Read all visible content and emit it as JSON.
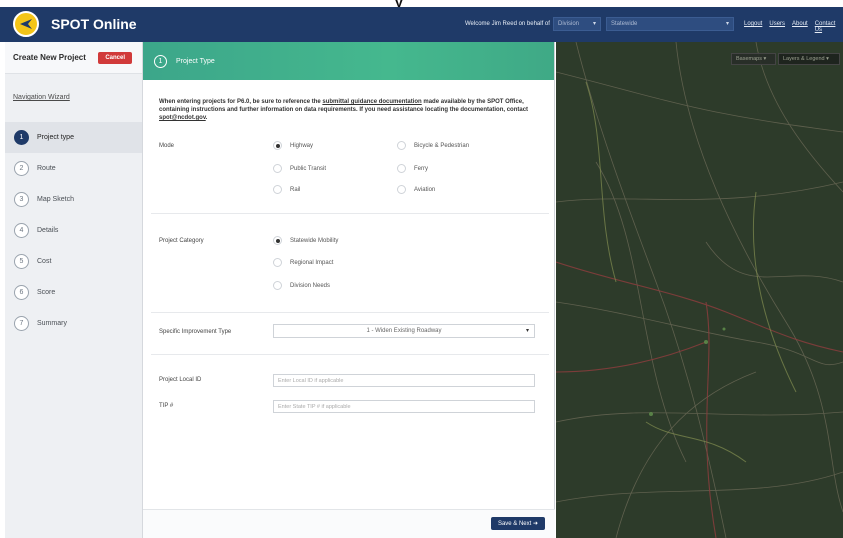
{
  "header": {
    "app_title": "SPOT Online",
    "welcome_text": "Welcome Jim Reed on behalf of",
    "region_select_value": "Division",
    "entity_select_value": "Statewide",
    "links": [
      "Logout",
      "Users",
      "About",
      "Contact Us"
    ]
  },
  "sidebar": {
    "title": "Create New Project",
    "cancel_label": "Cancel",
    "nav_wizard_label": "Navigation Wizard",
    "steps": [
      {
        "num": "1",
        "label": "Project type"
      },
      {
        "num": "2",
        "label": "Route"
      },
      {
        "num": "3",
        "label": "Map Sketch"
      },
      {
        "num": "4",
        "label": "Details"
      },
      {
        "num": "5",
        "label": "Cost"
      },
      {
        "num": "6",
        "label": "Score"
      },
      {
        "num": "7",
        "label": "Summary"
      }
    ]
  },
  "main": {
    "section_number": "1",
    "section_title": "Project Type",
    "intro_part1": "When entering projects for P6.0, be sure to reference the ",
    "intro_link": "submittal guidance documentation",
    "intro_part2": " made available by the SPOT Office, containing instructions and further information on data requirements. If you need assistance locating the documentation, contact ",
    "intro_email": "spot@ncdot.gov",
    "intro_end": ".",
    "mode_label": "Mode",
    "modes": [
      {
        "label": "Highway",
        "selected": true
      },
      {
        "label": "Bicycle & Pedestrian",
        "selected": false
      },
      {
        "label": "Public Transit",
        "selected": false
      },
      {
        "label": "Ferry",
        "selected": false
      },
      {
        "label": "Rail",
        "selected": false
      },
      {
        "label": "Aviation",
        "selected": false
      }
    ],
    "category_label": "Project Category",
    "categories": [
      {
        "label": "Statewide Mobility",
        "selected": true
      },
      {
        "label": "Regional Impact",
        "selected": false
      },
      {
        "label": "Division Needs",
        "selected": false
      }
    ],
    "improvement_label": "Specific Improvement Type",
    "improvement_value": "1 - Widen Existing Roadway",
    "local_id_label": "Project Local ID",
    "local_id_placeholder": "Enter Local ID if applicable",
    "tip_label": "TIP #",
    "tip_placeholder": "Enter State TIP # if applicable",
    "save_next_label": "Save & Next"
  },
  "map": {
    "basemap_button": "Basemaps",
    "layers_button": "Layers & Legend"
  },
  "colors": {
    "header_bg": "#1f3a68",
    "accent_green": "#45b88e",
    "cancel_red": "#d13a3a",
    "map_bg": "#2b3a27"
  }
}
